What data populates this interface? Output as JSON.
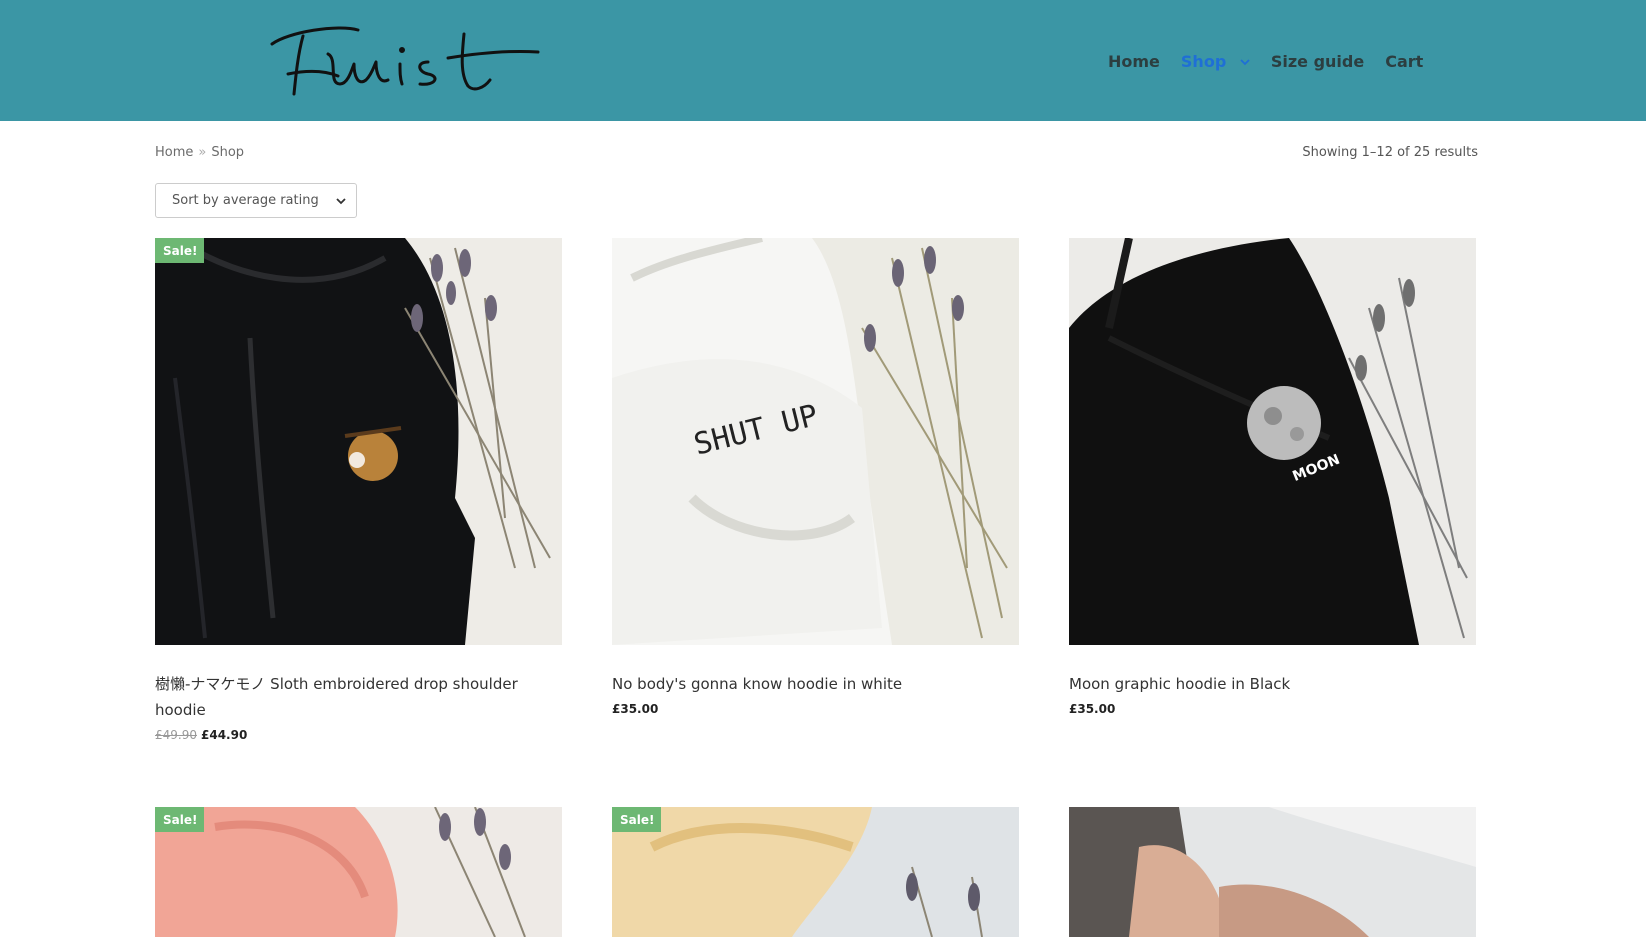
{
  "header": {
    "logo_text": "Twist",
    "nav": [
      {
        "label": "Home",
        "active": false
      },
      {
        "label": "Shop",
        "active": true,
        "has_dropdown": true
      },
      {
        "label": "Size guide",
        "active": false
      },
      {
        "label": "Cart",
        "active": false
      }
    ]
  },
  "breadcrumb": {
    "home": "Home",
    "separator": "»",
    "current": "Shop"
  },
  "result_count": "Showing 1–12 of 25 results",
  "sort": {
    "selected": "Sort by average rating"
  },
  "products": [
    {
      "title": "樹懶-ナマケモノ Sloth embroidered drop shoulder hoodie",
      "sale": true,
      "sale_label": "Sale!",
      "old_price": "£49.90",
      "price": "£44.90"
    },
    {
      "title": "No body's gonna know hoodie in white",
      "sale": false,
      "price": "£35.00",
      "print_text": "SHUT UP"
    },
    {
      "title": "Moon graphic hoodie in Black",
      "sale": false,
      "price": "£35.00",
      "print_text": "MOON"
    },
    {
      "sale": true,
      "sale_label": "Sale!"
    },
    {
      "sale": true,
      "sale_label": "Sale!"
    },
    {
      "sale": false
    }
  ],
  "colors": {
    "header_bg": "#3b96a5",
    "nav_active": "#1f6fd6",
    "sale_badge": "#6db873"
  }
}
